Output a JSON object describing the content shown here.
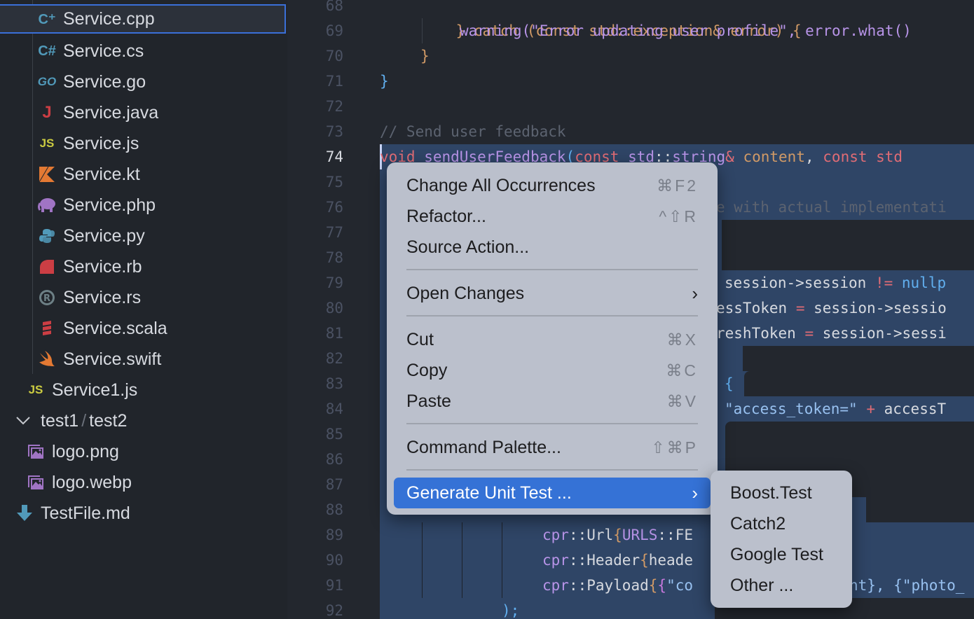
{
  "explorer": {
    "files": [
      {
        "name": "Service.cpp",
        "icon": "cpp-icon",
        "glyph": "C⁺",
        "color": "#519aba",
        "selected": true
      },
      {
        "name": "Service.cs",
        "icon": "csharp-icon",
        "glyph": "C#",
        "color": "#519aba"
      },
      {
        "name": "Service.go",
        "icon": "go-icon",
        "glyph": "GO",
        "color": "#519aba"
      },
      {
        "name": "Service.java",
        "icon": "java-icon",
        "glyph": "J",
        "color": "#cc3e44"
      },
      {
        "name": "Service.js",
        "icon": "js-icon",
        "glyph": "JS",
        "color": "#cbcb41"
      },
      {
        "name": "Service.kt",
        "icon": "kotlin-icon",
        "glyph": "◣",
        "color": "#e37933"
      },
      {
        "name": "Service.php",
        "icon": "php-icon",
        "glyph": "🐘",
        "color": "#a074c4"
      },
      {
        "name": "Service.py",
        "icon": "python-icon",
        "glyph": "✦",
        "color": "#519aba"
      },
      {
        "name": "Service.rb",
        "icon": "ruby-icon",
        "glyph": "◗",
        "color": "#cc3e44"
      },
      {
        "name": "Service.rs",
        "icon": "rust-icon",
        "glyph": "®",
        "color": "#6d8086"
      },
      {
        "name": "Service.scala",
        "icon": "scala-icon",
        "glyph": "≋",
        "color": "#cc3e44"
      },
      {
        "name": "Service.swift",
        "icon": "swift-icon",
        "glyph": "➶",
        "color": "#e37933"
      }
    ],
    "service1": {
      "name": "Service1.js",
      "glyph": "JS",
      "color": "#cbcb41"
    },
    "folder": {
      "part1": "test1",
      "sep": "/",
      "part2": "test2",
      "chevron": "⌵"
    },
    "folder_files": [
      {
        "name": "logo.png",
        "glyph": "🖼",
        "color": "#a074c4"
      },
      {
        "name": "logo.webp",
        "glyph": "🖼",
        "color": "#a074c4"
      }
    ],
    "testfile": {
      "name": "TestFile.md",
      "glyph": "⬇",
      "color": "#519aba"
    }
  },
  "editor": {
    "line_numbers": [
      "68",
      "69",
      "70",
      "71",
      "72",
      "73",
      "74",
      "75",
      "76",
      "77",
      "78",
      "79",
      "80",
      "81",
      "82",
      "83",
      "84",
      "85",
      "86",
      "87",
      "88",
      "89",
      "90",
      "91",
      "92"
    ],
    "active_line": "74",
    "code": {
      "l68": "} catch (const std::exception& error) {",
      "l69": "warning(\"Error updating user profile\", error.what()",
      "l70": "}",
      "l71": "}",
      "l73": "// Send user feedback",
      "l74_void": "void",
      "l74_fn": "sendUserFeedback",
      "l74_rest1": "const",
      "l74_std": "std",
      "l74_string": "string",
      "l74_content": "content",
      "l74_rest2": "const std",
      "l76": "e with actual implementati",
      "l79_a": "session->session",
      "l79_op": "!=",
      "l79_b": "nullp",
      "l80_a": "essToken",
      "l80_b": "session->sessio",
      "l81_a": "reshToken",
      "l81_b": "session->sessi",
      "l83": "{",
      "l84_str": "\"access_token=\"",
      "l84_op": "+",
      "l84_b": "accessT",
      "l89_a": "cpr",
      "l89_b": "Url",
      "l89_c": "URLS",
      "l89_d": "FE",
      "l90_b": "Header",
      "l90_d": "heade",
      "l91_b": "Payload",
      "l91_d": "\"co",
      "l91_e": "nt}, {\"photo_",
      "l92": ");"
    }
  },
  "context_menu": {
    "items": [
      {
        "label": "Change All Occurrences",
        "shortcut": "⌘F2"
      },
      {
        "label": "Refactor...",
        "shortcut": "^⇧R"
      },
      {
        "label": "Source Action..."
      },
      {
        "label": "Open Changes",
        "submenu": "›"
      },
      {
        "label": "Cut",
        "shortcut": "⌘X"
      },
      {
        "label": "Copy",
        "shortcut": "⌘C"
      },
      {
        "label": "Paste",
        "shortcut": "⌘V"
      },
      {
        "label": "Command Palette...",
        "shortcut": "⇧⌘P"
      },
      {
        "label": "Generate Unit Test ...",
        "submenu": "›",
        "highlighted": true
      }
    ]
  },
  "submenu": {
    "items": [
      "Boost.Test",
      "Catch2",
      "Google Test",
      "Other ..."
    ]
  }
}
